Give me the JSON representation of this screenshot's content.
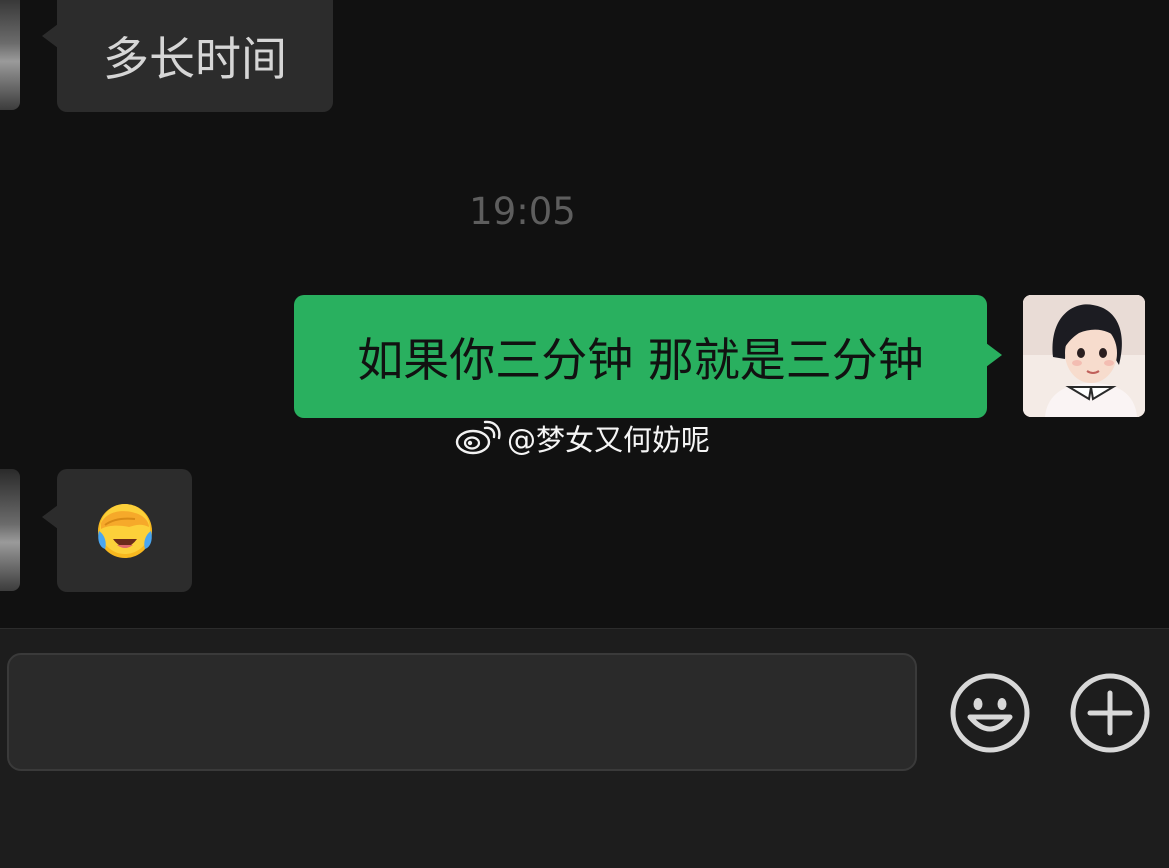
{
  "chat": {
    "messages": [
      {
        "direction": "incoming",
        "text": "多长时间"
      },
      {
        "direction": "outgoing",
        "text": "如果你三分钟 那就是三分钟"
      },
      {
        "direction": "incoming",
        "emoji_icon": "face-with-hand-over-eyes-laughing-emoji"
      }
    ],
    "timestamp": "19:05",
    "watermark": "@梦女又何妨呢"
  },
  "input": {
    "value": "",
    "emoji_button_icon": "smiley-icon",
    "more_button_icon": "plus-circle-icon"
  },
  "colors": {
    "background": "#111111",
    "incoming_bubble": "#2c2c2c",
    "outgoing_bubble": "#29b05f",
    "timestamp": "#5e5e5e",
    "input_bar": "#1d1d1d"
  }
}
